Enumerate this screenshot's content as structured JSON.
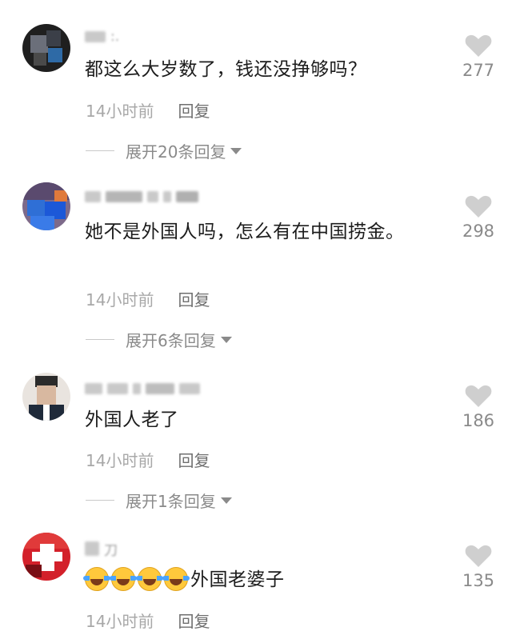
{
  "comments": [
    {
      "text": "都这么大岁数了，钱还没挣够吗？",
      "time": "14小时前",
      "reply_label": "回复",
      "expand_label": "展开20条回复",
      "likes": "277"
    },
    {
      "text": "她不是外国人吗，怎么有在中国捞金。",
      "time": "14小时前",
      "reply_label": "回复",
      "expand_label": "展开6条回复",
      "likes": "298"
    },
    {
      "text": "外国人老了",
      "time": "14小时前",
      "reply_label": "回复",
      "expand_label": "展开1条回复",
      "likes": "186"
    },
    {
      "text": "外国老婆子",
      "emoji_count": 4,
      "emoji_name": "laugh-cry-emoji",
      "time": "14小时前",
      "reply_label": "回复",
      "likes": "135"
    }
  ],
  "icons": {
    "like": "heart-icon",
    "expand": "caret-down-icon"
  },
  "colors": {
    "text": "#1c1c1c",
    "meta": "#a8a8a8",
    "reply": "#6f6f6f",
    "heart": "#cfcfcf"
  }
}
